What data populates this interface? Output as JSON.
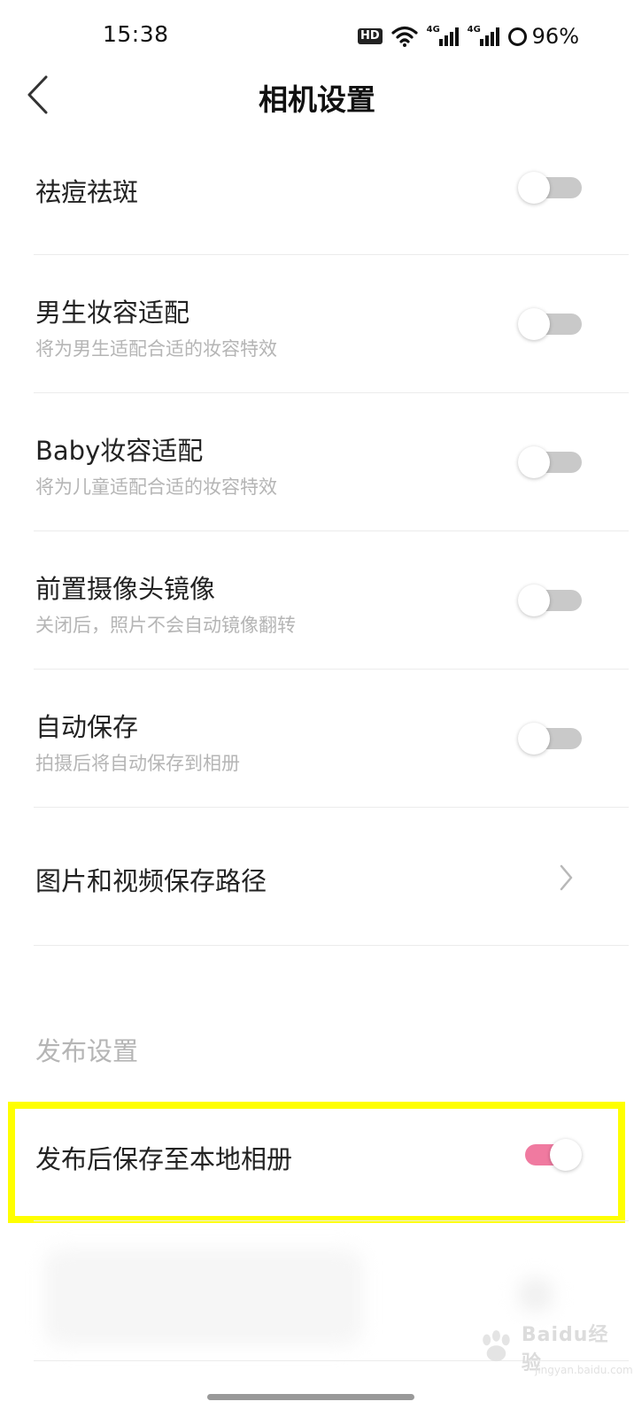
{
  "status_bar": {
    "time": "15:38",
    "hd_label": "HD",
    "network_1": "4G",
    "network_2": "4G",
    "battery": "96%"
  },
  "header": {
    "title": "相机设置",
    "back_icon": "chevron-left-icon"
  },
  "settings": [
    {
      "title": "祛痘祛斑",
      "subtitle": "",
      "control": "toggle",
      "on": false
    },
    {
      "title": "男生妆容适配",
      "subtitle": "将为男生适配合适的妆容特效",
      "control": "toggle",
      "on": false
    },
    {
      "title": "Baby妆容适配",
      "subtitle": "将为儿童适配合适的妆容特效",
      "control": "toggle",
      "on": false
    },
    {
      "title": "前置摄像头镜像",
      "subtitle": "关闭后，照片不会自动镜像翻转",
      "control": "toggle",
      "on": false
    },
    {
      "title": "自动保存",
      "subtitle": "拍摄后将自动保存到相册",
      "control": "toggle",
      "on": false
    },
    {
      "title": "图片和视频保存路径",
      "subtitle": "",
      "control": "chevron"
    }
  ],
  "publish_section": {
    "header": "发布设置",
    "items": [
      {
        "title": "发布后保存至本地相册",
        "control": "toggle",
        "on": true
      }
    ]
  },
  "colors": {
    "toggle_on": "#f07aa0",
    "toggle_off": "#c9c9c9",
    "highlight": "#ffff00",
    "subtitle": "#b5b5b5"
  },
  "watermark": {
    "text": "Baidu经验",
    "sub": "jingyan.baidu.com"
  }
}
